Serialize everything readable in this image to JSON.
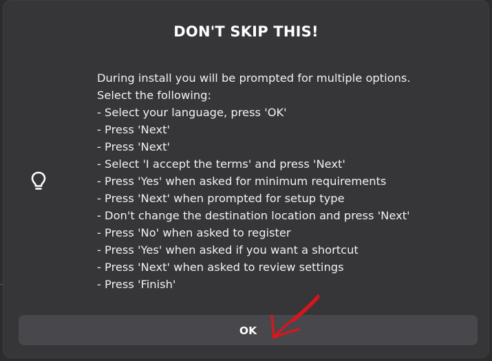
{
  "dialog": {
    "title": "DON'T SKIP THIS!",
    "icon": "lightbulb-icon",
    "message_lines": [
      "During install you will be prompted for multiple options.",
      "Select the following:",
      "- Select your language, press 'OK'",
      "- Press 'Next'",
      "- Press 'Next'",
      "- Select 'I accept the terms' and press 'Next'",
      "- Press 'Yes' when asked for minimum requirements",
      "- Press 'Next' when prompted for setup type",
      "- Don't change the destination location and press 'Next'",
      "- Press 'No' when asked to register",
      "- Press 'Yes' when asked if you want a shortcut",
      "- Press 'Next' when asked to review settings",
      "- Press 'Finish'"
    ],
    "ok_label": "OK"
  },
  "annotation": {
    "icon": "red-arrow-icon",
    "color": "#e0141c"
  },
  "colors": {
    "dialog_background": "#363538",
    "button_background": "#48474b",
    "text": "#ffffff"
  }
}
